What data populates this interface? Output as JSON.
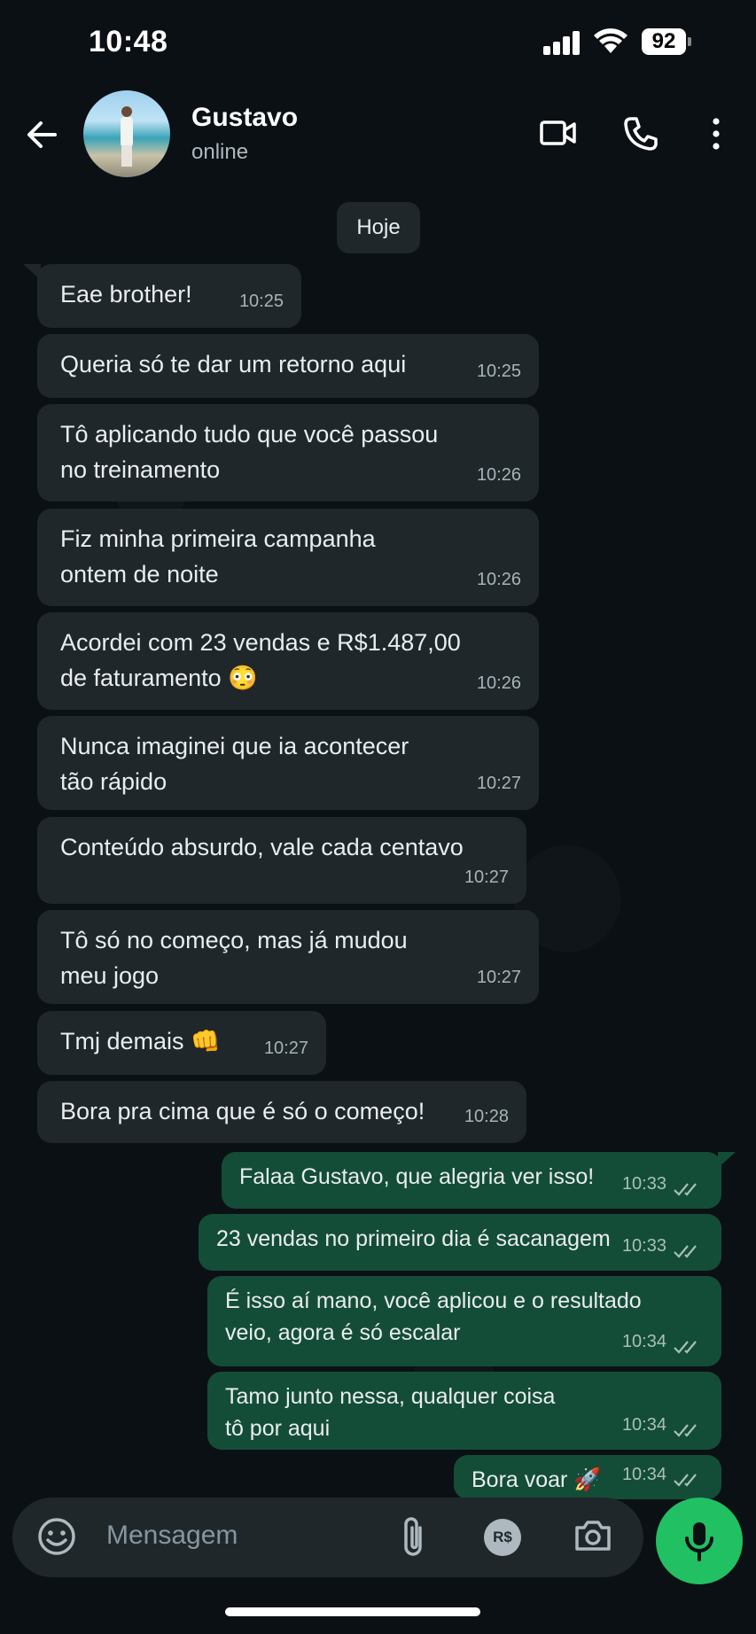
{
  "status_bar": {
    "time": "10:48",
    "battery": "92"
  },
  "header": {
    "name": "Gustavo",
    "status": "online"
  },
  "chat": {
    "date_chip": "Hoje",
    "incoming": [
      {
        "text": "Eae brother!",
        "time": "10:25"
      },
      {
        "text": "Queria só te dar um retorno aqui",
        "time": "10:25"
      },
      {
        "text": "Tô aplicando tudo que você passou\nno treinamento",
        "time": "10:26"
      },
      {
        "text": "Fiz minha primeira campanha\nontem de noite",
        "time": "10:26"
      },
      {
        "text": "Acordei com 23 vendas e R$1.487,00\nde faturamento 😳",
        "time": "10:26"
      },
      {
        "text": "Nunca imaginei que ia acontecer\ntão rápido",
        "time": "10:27"
      },
      {
        "text": "Conteúdo absurdo, vale cada centavo",
        "time": "10:27"
      },
      {
        "text": "Tô só no começo, mas já mudou\nmeu jogo",
        "time": "10:27"
      },
      {
        "text": "Tmj demais 👊",
        "time": "10:27"
      },
      {
        "text": "Bora pra cima que é só o começo!",
        "time": "10:28"
      }
    ],
    "outgoing": [
      {
        "text": "Falaa Gustavo, que alegria ver isso!",
        "time": "10:33"
      },
      {
        "text": "23 vendas no primeiro dia é sacanagem",
        "time": "10:33"
      },
      {
        "text": "É isso aí mano, você aplicou e o resultado\nveio, agora é só escalar",
        "time": "10:34"
      },
      {
        "text": "Tamo junto nessa, qualquer coisa\ntô por aqui",
        "time": "10:34"
      },
      {
        "text": "Bora voar 🚀",
        "time": "10:34"
      }
    ]
  },
  "input": {
    "placeholder": "Mensagem",
    "pay_icon_label": "R$"
  },
  "colors": {
    "incoming_bubble": "#1f272a",
    "outgoing_bubble": "#144d37",
    "mic_button": "#21c063",
    "read_ticks": "#a7c1b5"
  },
  "icons": [
    "back-arrow-icon",
    "video-call-icon",
    "phone-icon",
    "more-vert-icon",
    "emoji-icon",
    "attach-icon",
    "payment-icon",
    "camera-icon",
    "mic-icon",
    "double-check-icon"
  ]
}
